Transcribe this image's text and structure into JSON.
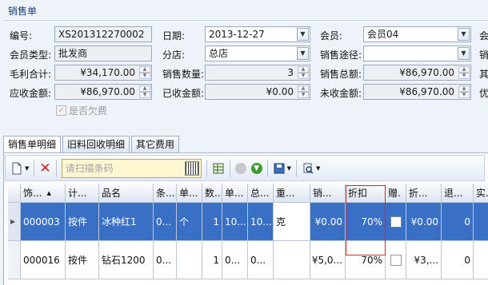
{
  "header": {
    "title": "销售单"
  },
  "form": {
    "order_no_label": "编号:",
    "order_no": "XS201312270002",
    "date_label": "日期:",
    "date": "2013-12-27",
    "member_label": "会员:",
    "member": "会员04",
    "member_type_label": "会员类型:",
    "member_type": "批发商",
    "branch_label": "分店:",
    "branch": "总店",
    "channel_label": "销售途径:",
    "channel": "",
    "gross_profit_label": "毛利合计:",
    "gross_profit": "¥34,170.00",
    "qty_label": "销售数量:",
    "qty": "3",
    "sales_total_label": "销售总额:",
    "sales_total": "¥86,970.00",
    "receivable_label": "应收金额:",
    "receivable": "¥86,970.00",
    "received_label": "已收金额:",
    "received": "¥0.00",
    "unreceived_label": "未收金额:",
    "unreceived": "¥86,970.00",
    "overdue_label": "是否欠费",
    "overdue_checked": true
  },
  "tabs": [
    {
      "label": "销售单明细"
    },
    {
      "label": "旧料回收明细"
    },
    {
      "label": "其它费用"
    }
  ],
  "toolbar": {
    "scan_placeholder": "请扫描条码"
  },
  "table": {
    "columns": [
      "饰...",
      "计...",
      "品名",
      "条...",
      "单...",
      "数...",
      "单...",
      "总...",
      "重...",
      "销...",
      "折扣",
      "赠.",
      "折...",
      "退...",
      "实."
    ],
    "rows": [
      [
        "000003",
        "按件",
        "冰种红1",
        "0...",
        "个",
        "1",
        "10...",
        "10...",
        "克",
        "¥0.00",
        "70%",
        "",
        "¥0.00",
        "0",
        "0"
      ],
      [
        "000016",
        "按件",
        "钻石1200",
        "0...",
        "",
        "1",
        "0...",
        "0...",
        "",
        "¥5,0...",
        "70%",
        "",
        "¥3,...",
        "0",
        "0"
      ]
    ]
  }
}
